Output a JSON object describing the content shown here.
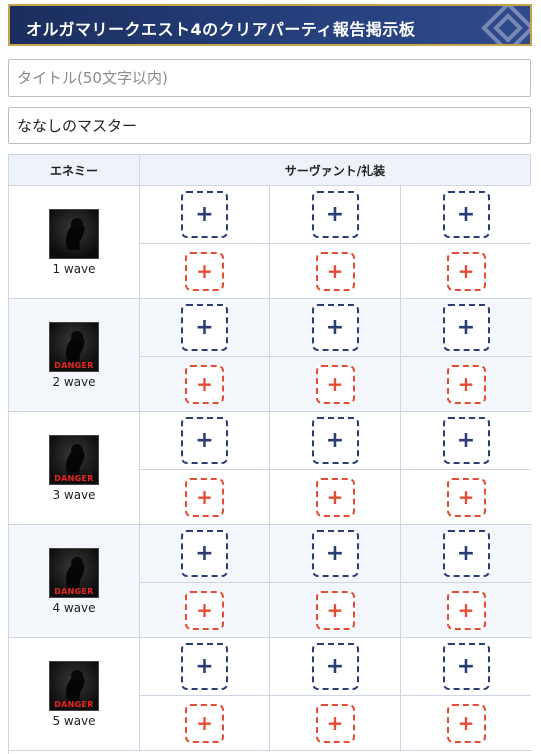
{
  "header": {
    "title": "オルガマリークエスト4のクリアパーティ報告掲示板"
  },
  "form": {
    "title_placeholder": "タイトル(50文字以内)",
    "author_value": "ななしのマスター"
  },
  "table": {
    "col_enemy": "エネミー",
    "col_servants": "サーヴァント/礼装",
    "waves": [
      {
        "label": "1 wave",
        "danger": ""
      },
      {
        "label": "2 wave",
        "danger": "DANGER"
      },
      {
        "label": "3 wave",
        "danger": "DANGER"
      },
      {
        "label": "4 wave",
        "danger": "DANGER"
      },
      {
        "label": "5 wave",
        "danger": "DANGER"
      }
    ],
    "servant_add": "+",
    "ce_add": "+"
  },
  "colors": {
    "header_bg": "#263f7c",
    "header_border": "#c6a44a",
    "servant_accent": "#2b3e73",
    "ce_accent": "#e44d34"
  }
}
